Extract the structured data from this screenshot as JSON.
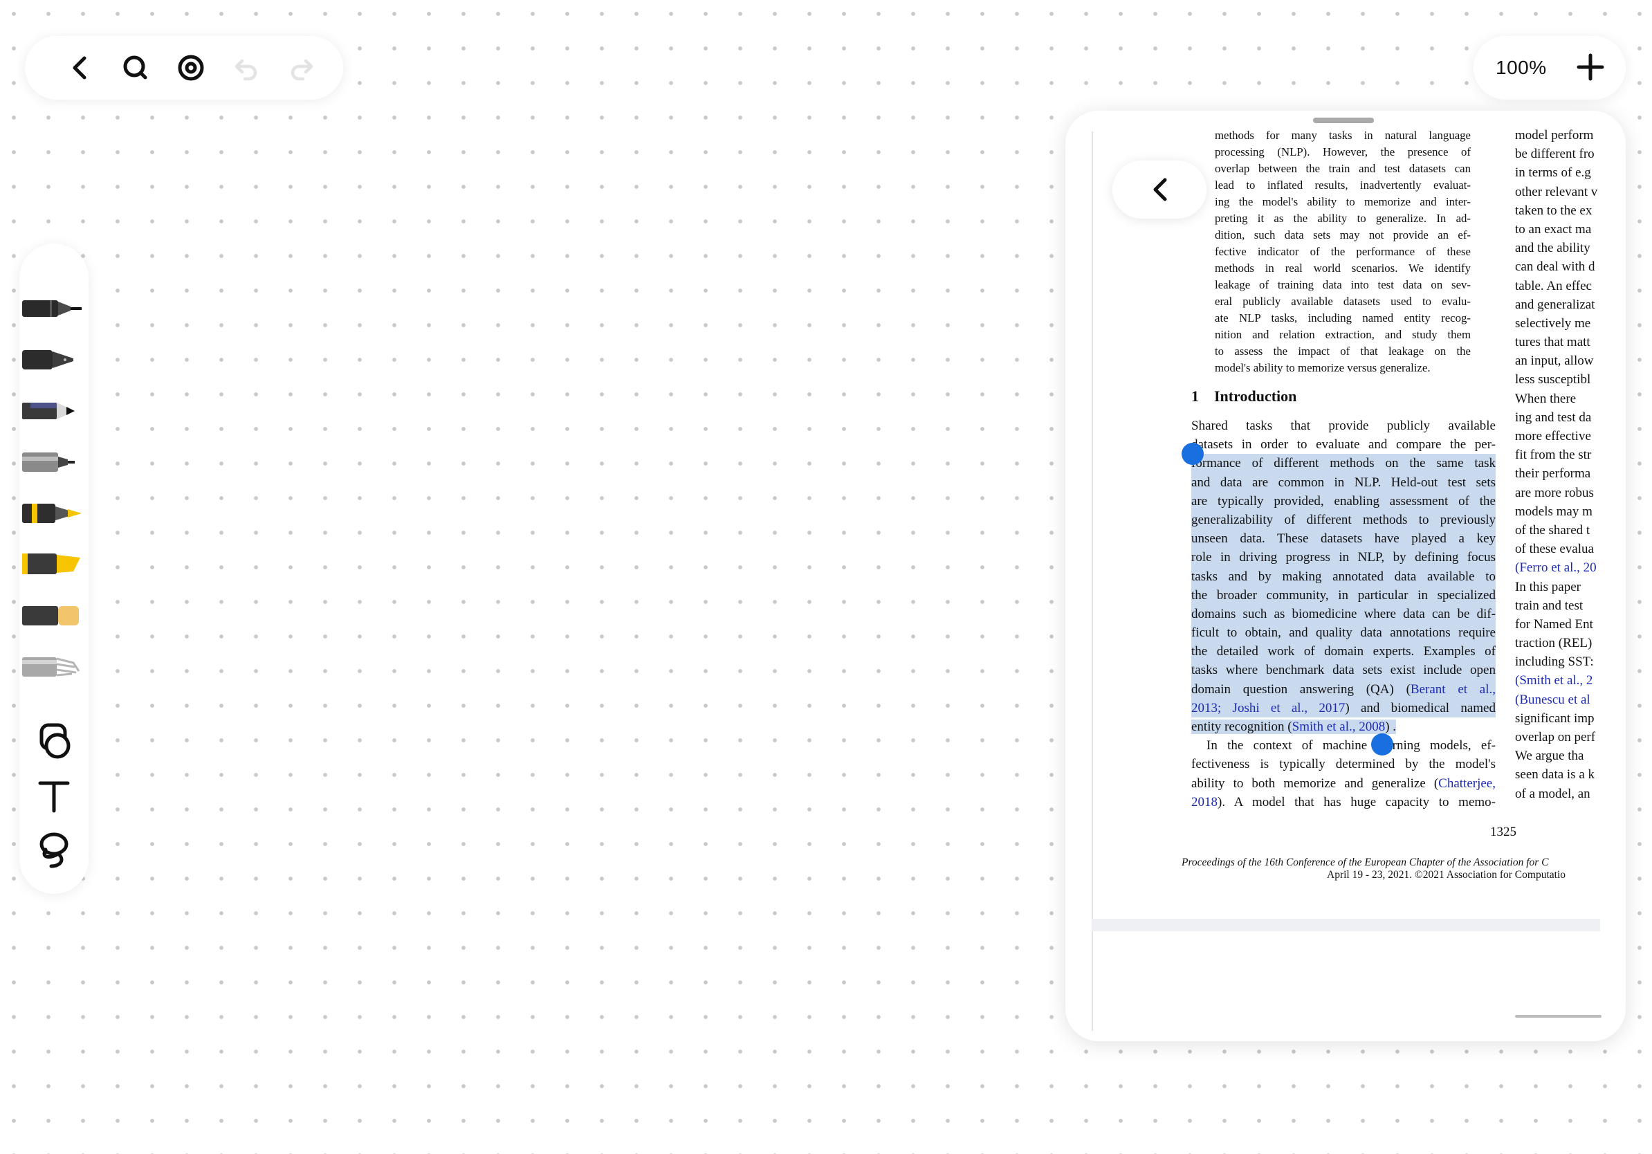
{
  "toolbar": {
    "back_icon": "chevron-left-icon",
    "search_icon": "search-icon",
    "target_icon": "target-icon",
    "undo_icon": "undo-icon",
    "redo_icon": "redo-icon"
  },
  "zoom": {
    "level": "100%",
    "plus_icon": "plus-icon"
  },
  "tools": [
    "pen",
    "fountain-pen",
    "pencil",
    "marker",
    "highlighter-yellow",
    "highlighter-chisel",
    "eraser",
    "brush",
    "shapes",
    "text",
    "lasso"
  ],
  "document": {
    "abstract_lines": [
      "methods for many tasks in natural language",
      "processing (NLP). However, the presence of",
      "overlap between the train and test datasets can",
      "lead to inflated results, inadvertently evaluat-",
      "ing the model's ability to memorize and inter-",
      "preting it as the ability to generalize. In ad-",
      "dition, such data sets may not provide an ef-",
      "fective indicator of the performance of these",
      "methods in real world scenarios. We identify",
      "leakage of training data into test data on sev-",
      "eral publicly available datasets used to evalu-",
      "ate NLP tasks, including named entity recog-",
      "nition and relation extraction, and study them",
      "to assess the impact of that leakage on the",
      "model's ability to memorize versus generalize."
    ],
    "section_number": "1",
    "section_title": "Introduction",
    "intro_line_1": "Shared tasks that provide publicly available",
    "intro_line_2": "datasets in order to evaluate and compare the per-",
    "highlighted_lines": [
      "formance of different methods on the same task",
      "and data are common in NLP. Held-out test sets",
      "are typically provided, enabling assessment of the",
      "generalizability of different methods to previously",
      "unseen data. These datasets have played a key",
      "role in driving progress in NLP, by defining focus",
      "tasks and by making annotated data available to",
      "the broader community, in particular in specialized",
      "domains such as biomedicine where data can be dif-",
      "ficult to obtain, and quality data annotations require",
      "the detailed work of domain experts. Examples of",
      "tasks where benchmark data sets exist include open"
    ],
    "hl_qa_prefix": "domain question answering (QA) (",
    "hl_qa_cite": "Berant et al.,",
    "hl_joshi_cite": "2013; Joshi et al., 2017",
    "hl_joshi_suffix": ") and biomedical named",
    "hl_ner_prefix": "entity recognition (",
    "hl_ner_cite": "Smith et al., 2008",
    "hl_ner_suffix": ") .",
    "para2_line_1": "In the context of machine learning models, ef-",
    "para2_line_2": "fectiveness is typically determined by the model's",
    "para2_line_3_prefix": "ability to both memorize and generalize (",
    "para2_line_3_cite": "Chatterjee,",
    "para2_line_4_cite": "2018",
    "para2_line_4_suffix": "). A model that has huge capacity to memo-",
    "page_number": "1325",
    "footer_line_1": "Proceedings of the 16th Conference of the European Chapter of the Association for C",
    "footer_line_2": "April 19 - 23, 2021. ©2021 Association for Computatio",
    "right_column_lines": [
      "model perform",
      "be different fro",
      "in terms of e.g",
      "other relevant v",
      "taken to the ex",
      "to an exact ma",
      "and the ability",
      "can deal with d",
      "table. An effec",
      "and generalizat",
      "selectively me",
      "tures that matt",
      "an input, allow",
      "less susceptibl",
      "When there",
      "ing and test da",
      "more effective",
      "fit from the str",
      "their performa",
      "are more robus",
      "models may m",
      "of the shared t",
      "of these evalua",
      "(Ferro et al., 20",
      "In this paper",
      "train and test",
      "for Named Ent",
      "traction (REL)",
      "including SST:",
      "(Smith et al., 2",
      "(Bunescu et al",
      "significant imp",
      "overlap on perf",
      "We argue tha",
      "seen data is a k",
      "of a model, an"
    ],
    "right_column_cite_indices": [
      23,
      29,
      30
    ]
  }
}
